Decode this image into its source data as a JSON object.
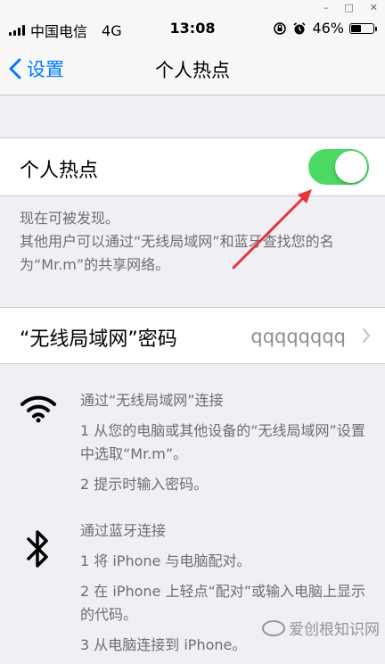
{
  "status_bar": {
    "carrier": "中国电信",
    "network": "4G",
    "time": "13:08",
    "battery_percent": "46%",
    "battery_level": 0.46
  },
  "window_controls": {
    "minimize": "–",
    "maximize": "□",
    "close": "✕"
  },
  "nav": {
    "back_label": "设置",
    "title": "个人热点"
  },
  "hotspot": {
    "label": "个人热点",
    "enabled": true,
    "toggle_color": "#4cd964"
  },
  "discoverable_text": "现在可被发现。",
  "info_text": "其他用户可以通过“无线局域网”和蓝牙查找您的名为“Mr.m”的共享网络。",
  "wifi_password": {
    "label": "“无线局域网”密码",
    "value": "qqqqqqqq"
  },
  "help": {
    "wifi": {
      "icon": "wifi-icon",
      "title": "通过“无线局域网”连接",
      "step1": "1 从您的电脑或其他设备的“无线局域网”设置中选取“Mr.m”。",
      "step2": "2 提示时输入密码。"
    },
    "bluetooth": {
      "icon": "bluetooth-icon",
      "title": "通过蓝牙连接",
      "step1": "1 将 iPhone 与电脑配对。",
      "step2": "2 在 iPhone 上轻点“配对”或输入电脑上显示的代码。",
      "step3": "3 从电脑连接到 iPhone。"
    }
  },
  "annotation": {
    "color": "#e8333a"
  },
  "watermark": {
    "text": "爱创根知识网"
  },
  "accent_color": "#007aff"
}
